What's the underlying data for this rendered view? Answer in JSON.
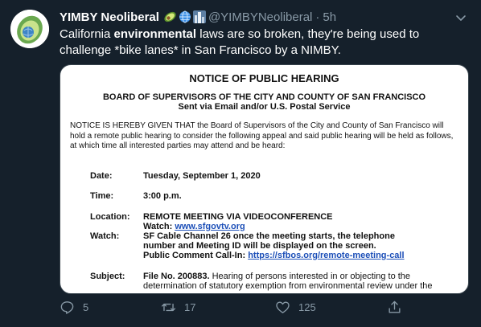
{
  "tweet": {
    "author_name": "YIMBY Neoliberal",
    "author_handle": "@YIMBYNeoliberal",
    "separator": "·",
    "time": "5h",
    "author_emojis": [
      "avocado-icon",
      "globe-icon",
      "cityscape-icon"
    ],
    "text": {
      "part1": "California ",
      "bold": "environmental",
      "part2": " laws are so broken, they're being used to challenge *bike lanes* in San Francisco by a NIMBY."
    }
  },
  "document": {
    "title": "NOTICE OF PUBLIC HEARING",
    "board": "BOARD OF SUPERVISORS OF THE CITY AND COUNTY OF SAN FRANCISCO",
    "sent": "Sent via Email and/or U.S. Postal Service",
    "notice": "NOTICE IS HEREBY GIVEN THAT the Board of Supervisors of the City and County of San Francisco will hold a remote public hearing to consider the following appeal and said public hearing will be held as follows, at which time all interested parties may attend and be heard:",
    "date_label": "Date:",
    "date_value": "Tuesday, September 1, 2020",
    "time_label": "Time:",
    "time_value": "3:00 p.m.",
    "location_label": "Location:",
    "location_value": "REMOTE MEETING VIA VIDEOCONFERENCE",
    "watch_label": "Watch:",
    "watch_line1_prefix": "Watch: ",
    "watch_line1_link": "www.sfgovtv.org",
    "watch_line2": "SF Cable Channel 26 once the meeting starts, the telephone",
    "watch_line3": "number and Meeting ID will be displayed on the screen.",
    "watch_line4_prefix": "Public Comment Call-In: ",
    "watch_line4_link": "https://sfbos.org/remote-meeting-call",
    "subject_label": "Subject:",
    "subject_file": "File No. 200883.",
    "subject_line1_rest": "  Hearing of persons interested in or objecting to the",
    "subject_line2": "determination of statutory exemption from environmental review under the"
  },
  "actions": {
    "reply_count": "5",
    "retweet_count": "17",
    "like_count": "125"
  },
  "colors": {
    "background": "#15202b",
    "secondary_text": "#8899a6",
    "link": "#1c4fb8"
  }
}
